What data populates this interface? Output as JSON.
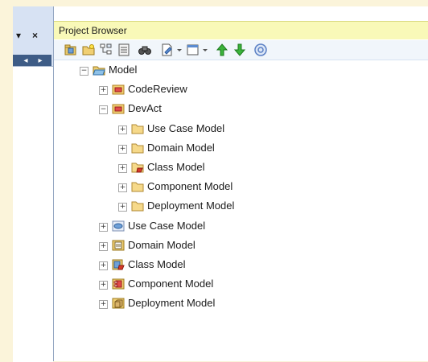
{
  "window": {
    "dock_pin_glyph": "▾",
    "dock_close_glyph": "×",
    "nav_prev_glyph": "◂",
    "nav_next_glyph": "▸"
  },
  "panel": {
    "title": "Project Browser"
  },
  "toolbar": {
    "buttons": [
      {
        "name": "new-package-icon"
      },
      {
        "name": "new-folder-icon"
      },
      {
        "name": "new-diagram-icon"
      },
      {
        "name": "new-element-icon"
      },
      {
        "name": "find-binoculars-icon"
      },
      {
        "name": "document-dropdown-icon"
      },
      {
        "name": "window-dropdown-icon"
      },
      {
        "name": "move-up-arrow-icon"
      },
      {
        "name": "move-down-arrow-icon"
      },
      {
        "name": "help-icon"
      }
    ],
    "colors": {
      "up_arrow": "#3bb33b",
      "down_arrow": "#3bb33b",
      "help": "#5a7fc4"
    }
  },
  "tree": {
    "collapsed_glyph": "+",
    "expanded_glyph": "−",
    "nodes": [
      {
        "label": "Model",
        "state": "expanded",
        "icon": "root-model-icon"
      },
      {
        "label": "CodeReview",
        "state": "collapsed",
        "icon": "package-icon"
      },
      {
        "label": "DevAct",
        "state": "expanded",
        "icon": "package-icon"
      },
      {
        "label": "Use Case Model",
        "state": "collapsed",
        "icon": "folder-icon"
      },
      {
        "label": "Domain Model",
        "state": "collapsed",
        "icon": "folder-icon"
      },
      {
        "label": "Class Model",
        "state": "collapsed",
        "icon": "class-folder-icon"
      },
      {
        "label": "Component Model",
        "state": "collapsed",
        "icon": "folder-icon"
      },
      {
        "label": "Deployment Model",
        "state": "collapsed",
        "icon": "folder-icon"
      },
      {
        "label": "Use Case Model",
        "state": "collapsed",
        "icon": "use-case-view-icon"
      },
      {
        "label": "Domain Model",
        "state": "collapsed",
        "icon": "domain-view-icon"
      },
      {
        "label": "Class Model",
        "state": "collapsed",
        "icon": "class-view-icon"
      },
      {
        "label": "Component Model",
        "state": "collapsed",
        "icon": "component-view-icon"
      },
      {
        "label": "Deployment Model",
        "state": "collapsed",
        "icon": "deployment-view-icon"
      }
    ]
  }
}
